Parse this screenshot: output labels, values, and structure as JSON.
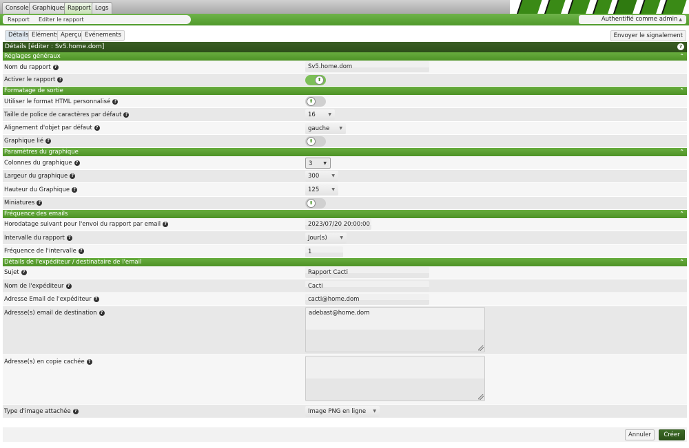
{
  "top_tabs": [
    {
      "label": "Console",
      "active": false
    },
    {
      "label": "Graphiques",
      "active": false
    },
    {
      "label": "Rapport",
      "active": true
    },
    {
      "label": "Logs",
      "active": false
    }
  ],
  "breadcrumb": {
    "items": [
      "Rapport",
      "Editer le rapport"
    ]
  },
  "auth_label": "Authentifié comme admin",
  "sub_tabs": [
    {
      "label": "Détails",
      "active": true
    },
    {
      "label": "Eléments",
      "active": false
    },
    {
      "label": "Aperçu",
      "active": false
    },
    {
      "label": "Evénements",
      "active": false
    }
  ],
  "send_button": "Envoyer le signalement",
  "panel_title": "Détails [éditer : Sv5.home.dom]",
  "sections": {
    "general": {
      "title": "Réglages généraux",
      "report_name": {
        "label": "Nom du rapport",
        "value": "Sv5.home.dom"
      },
      "enable_report": {
        "label": "Activer le rapport",
        "checked": true
      }
    },
    "output": {
      "title": "Formatage de sortie",
      "custom_html": {
        "label": "Utiliser le format HTML personnalisé",
        "checked": false
      },
      "font_size": {
        "label": "Taille de police de caractères par défaut",
        "value": "16"
      },
      "alignment": {
        "label": "Alignement d'objet par défaut",
        "value": "gauche"
      },
      "graph_linked": {
        "label": "Graphique lié",
        "checked": false
      }
    },
    "graph": {
      "title": "Paramètres du graphique",
      "columns": {
        "label": "Colonnes du graphique",
        "value": "3"
      },
      "width": {
        "label": "Largeur du graphique",
        "value": "300"
      },
      "height": {
        "label": "Hauteur du Graphique",
        "value": "125"
      },
      "thumbnails": {
        "label": "Miniatures",
        "checked": false
      }
    },
    "email_freq": {
      "title": "Fréquence des emails",
      "next_timestamp": {
        "label": "Horodatage suivant pour l'envoi du rapport par email",
        "value": "2023/07/20 20:00:00"
      },
      "interval": {
        "label": "Intervalle du rapport",
        "value": "Jour(s)"
      },
      "interval_freq": {
        "label": "Fréquence de l'intervalle",
        "value": "1"
      }
    },
    "sender": {
      "title": "Détails de l'expéditeur / destinataire de l'email",
      "subject": {
        "label": "Sujet",
        "value": "Rapport Cacti"
      },
      "sender_name": {
        "label": "Nom de l'expéditeur",
        "value": "Cacti"
      },
      "sender_email": {
        "label": "Adresse Email de l'expéditeur",
        "value": "cacti@home.dom"
      },
      "dest_email": {
        "label": "Adresse(s) email de destination",
        "value": "adebast@home.dom"
      },
      "bcc": {
        "label": "Adresse(s) en copie cachée",
        "value": ""
      },
      "image_type": {
        "label": "Type d'image attachée",
        "value": "Image PNG en ligne"
      }
    }
  },
  "buttons": {
    "cancel": "Annuler",
    "create": "Créer"
  },
  "colors": {
    "accent_green": "#4e9326",
    "dark_green": "#2d4e19"
  }
}
